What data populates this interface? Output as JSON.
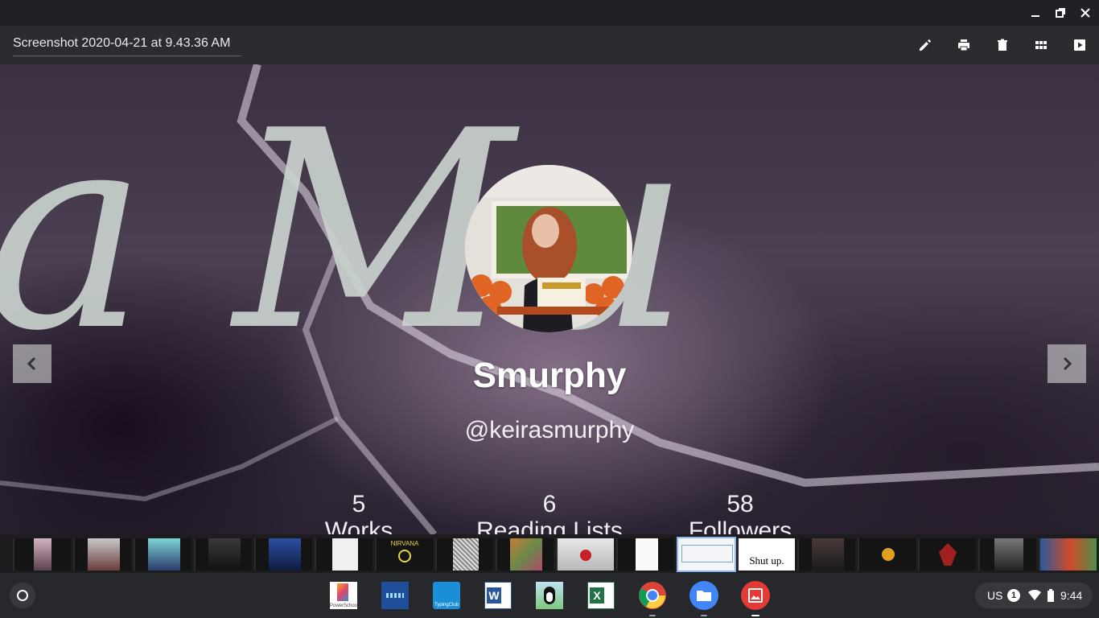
{
  "window": {
    "title": "Screenshot 2020-04-21 at 9.43.36 AM",
    "controls": [
      "minimize-icon",
      "restore-icon",
      "close-icon"
    ]
  },
  "toolbar": {
    "tools": [
      "edit-icon",
      "print-icon",
      "delete-icon",
      "gallery-icon",
      "slideshow-icon"
    ]
  },
  "profile": {
    "background_text": "a Mu",
    "name": "Smurphy",
    "handle": "@keirasmurphy",
    "stats": [
      {
        "value": "5",
        "label": "Works"
      },
      {
        "value": "6",
        "label": "Reading Lists"
      },
      {
        "value": "58",
        "label": "Followers"
      }
    ]
  },
  "filmstrip": {
    "thumbnails": [
      {
        "caption": ""
      },
      {
        "caption": ""
      },
      {
        "caption": ""
      },
      {
        "caption": ""
      },
      {
        "caption": ""
      },
      {
        "caption": ""
      },
      {
        "caption": "NIRVANA"
      },
      {
        "caption": ""
      },
      {
        "caption": ""
      },
      {
        "caption": ""
      },
      {
        "caption": ""
      },
      {
        "caption": ""
      },
      {
        "caption": "Shut up."
      },
      {
        "caption": ""
      },
      {
        "caption": ""
      },
      {
        "caption": ""
      },
      {
        "caption": ""
      },
      {
        "caption": ""
      }
    ],
    "selected_index": 11
  },
  "shelf": {
    "apps": [
      {
        "name": "PowerSchool",
        "label": "PowerSchool"
      },
      {
        "name": "Measures"
      },
      {
        "name": "TypingClub",
        "label": "TypingClub"
      },
      {
        "name": "Word",
        "label": "W"
      },
      {
        "name": "Penguin"
      },
      {
        "name": "Excel",
        "label": "X"
      },
      {
        "name": "Chrome"
      },
      {
        "name": "Files"
      },
      {
        "name": "Gallery"
      }
    ],
    "tray": {
      "ime": "US",
      "notifications": "1",
      "time": "9:44"
    }
  },
  "colors": {
    "titlebar": "#202124",
    "toolbar": "#2b2c2f",
    "shelf": "#27282b",
    "selection": "#8ab4f8"
  }
}
